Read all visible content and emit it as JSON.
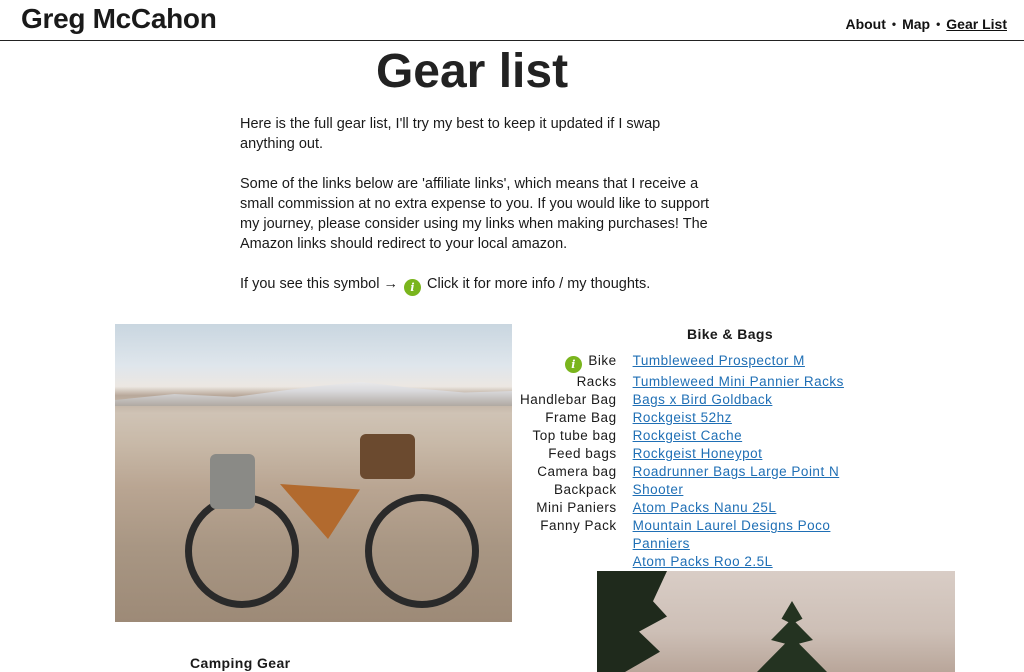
{
  "header": {
    "site_title": "Greg McCahon",
    "nav": [
      {
        "label": "About"
      },
      {
        "label": "Map"
      },
      {
        "label": "Gear List",
        "active": true
      }
    ],
    "separator": "•"
  },
  "page": {
    "title": "Gear list",
    "intro_1": "Here is the full gear list, I'll try my best to keep it updated if I swap anything out.",
    "intro_2": "Some of the links below are 'affiliate links', which means that I receive a small commission at no extra expense to you. If you would like to support my journey, please consider using my links when making purchases! The Amazon links should redirect to your local amazon.",
    "intro_3_prefix": "If you see this symbol →",
    "intro_3_suffix": "Click it for more info / my thoughts.",
    "info_icon": "info-circle-icon",
    "info_icon_glyph": "i",
    "info_color": "#7ab51d",
    "link_color": "#1f6fb5"
  },
  "bike_bags": {
    "heading": "Bike & Bags",
    "rows": [
      {
        "label": "Bike",
        "link": "Tumbleweed Prospector M",
        "has_info": true
      },
      {
        "label": "Racks",
        "link": "Tumbleweed Mini Pannier Racks"
      },
      {
        "label": "Handlebar Bag",
        "link": "Bags x Bird Goldback"
      },
      {
        "label": "Frame Bag",
        "link": "Rockgeist 52hz"
      },
      {
        "label": "Top tube bag",
        "link": "Rockgeist Cache"
      },
      {
        "label": "Feed bags",
        "link": "Rockgeist Honeypot"
      },
      {
        "label": "Camera bag",
        "link": "Roadrunner Bags Large Point N "
      },
      {
        "label": "Backpack",
        "link": "Shooter"
      },
      {
        "label": "Mini Paniers",
        "link": "Atom Packs Nanu 25L "
      },
      {
        "label": "Fanny Pack",
        "link": "Mountain Laurel Designs Poco "
      },
      {
        "label": "",
        "link": "Panniers"
      },
      {
        "label": "",
        "link": "Atom Packs Roo 2.5L"
      }
    ]
  },
  "camping": {
    "heading": "Camping Gear"
  }
}
